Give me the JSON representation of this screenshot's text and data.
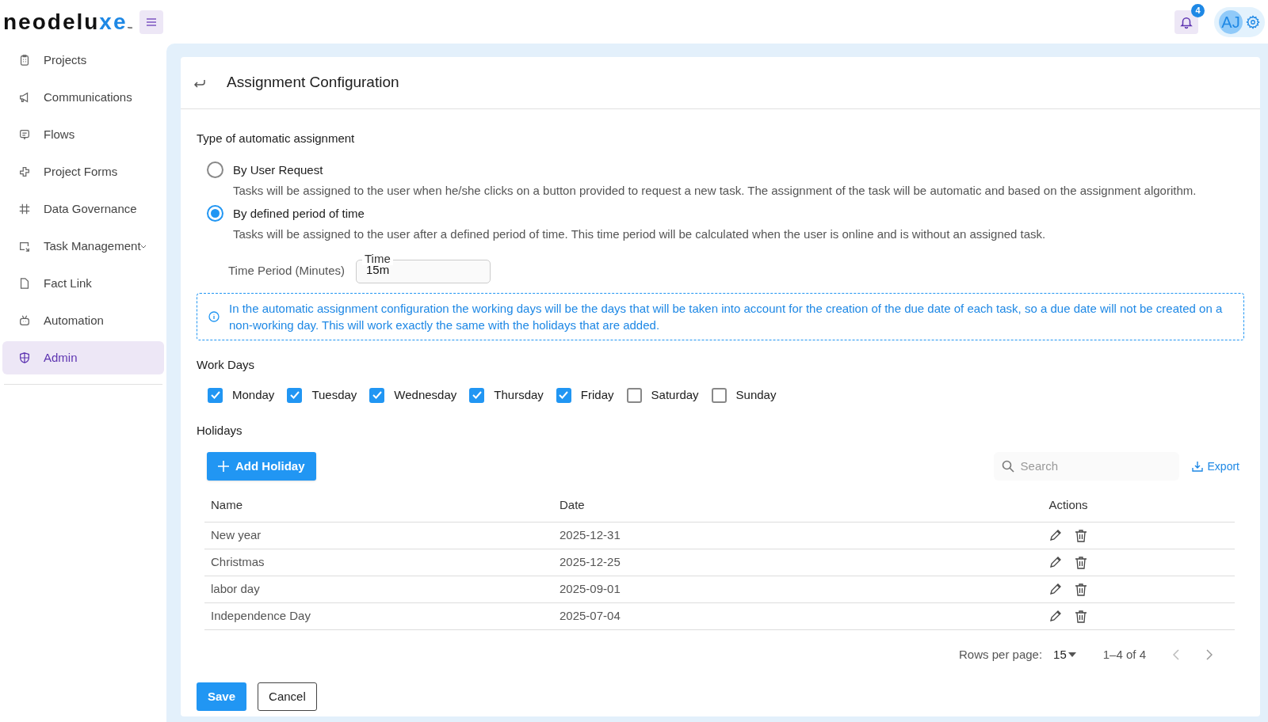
{
  "header": {
    "logo_dark": "neodelu",
    "logo_accent": "xe",
    "logo_mark": "™",
    "notification_count": "4",
    "avatar_initials": "AJ"
  },
  "sidebar": {
    "items": [
      {
        "label": "Projects",
        "selected": false,
        "expandable": false
      },
      {
        "label": "Communications",
        "selected": false,
        "expandable": false
      },
      {
        "label": "Flows",
        "selected": false,
        "expandable": false
      },
      {
        "label": "Project Forms",
        "selected": false,
        "expandable": false
      },
      {
        "label": "Data Governance",
        "selected": false,
        "expandable": false
      },
      {
        "label": "Task Management",
        "selected": false,
        "expandable": true
      },
      {
        "label": "Fact Link",
        "selected": false,
        "expandable": false
      },
      {
        "label": "Automation",
        "selected": false,
        "expandable": false
      },
      {
        "label": "Admin",
        "selected": true,
        "expandable": false
      }
    ]
  },
  "page": {
    "title": "Assignment Configuration",
    "assignment_heading": "Type of automatic assignment",
    "options": [
      {
        "label": "By User Request",
        "description": "Tasks will be assigned to the user when he/she clicks on a button provided to request a new task. The assignment of the task will be automatic and based on the assignment algorithm.",
        "selected": false
      },
      {
        "label": "By defined period of time",
        "description": "Tasks will be assigned to the user after a defined period of time. This time period will be calculated when the user is online and is without an assigned task.",
        "selected": true
      }
    ],
    "time_period": {
      "label": "Time Period (Minutes)",
      "field_label": "Time",
      "value": "15m"
    },
    "info": "In the automatic assignment configuration the working days will be the days that will be taken into account for the creation of the due date of each task, so a due date will not be created on a non-working day. This will work exactly the same with the holidays that are added.",
    "work_days_heading": "Work Days",
    "work_days": [
      {
        "label": "Monday",
        "checked": true
      },
      {
        "label": "Tuesday",
        "checked": true
      },
      {
        "label": "Wednesday",
        "checked": true
      },
      {
        "label": "Thursday",
        "checked": true
      },
      {
        "label": "Friday",
        "checked": true
      },
      {
        "label": "Saturday",
        "checked": false
      },
      {
        "label": "Sunday",
        "checked": false
      }
    ],
    "holidays_heading": "Holidays",
    "add_button": "Add Holiday",
    "search": {
      "placeholder": "Search"
    },
    "export_button": "Export",
    "table": {
      "columns": [
        "Name",
        "Date",
        "Actions"
      ],
      "rows": [
        {
          "name": "New year",
          "date": "2025-12-31"
        },
        {
          "name": "Christmas",
          "date": "2025-12-25"
        },
        {
          "name": "labor day",
          "date": "2025-09-01"
        },
        {
          "name": "Independence Day",
          "date": "2025-07-04"
        }
      ]
    },
    "pagination": {
      "rows_label": "Rows per page:",
      "rows_value": "15",
      "range": "1–4 of 4"
    },
    "buttons": {
      "save": "Save",
      "cancel": "Cancel"
    }
  }
}
